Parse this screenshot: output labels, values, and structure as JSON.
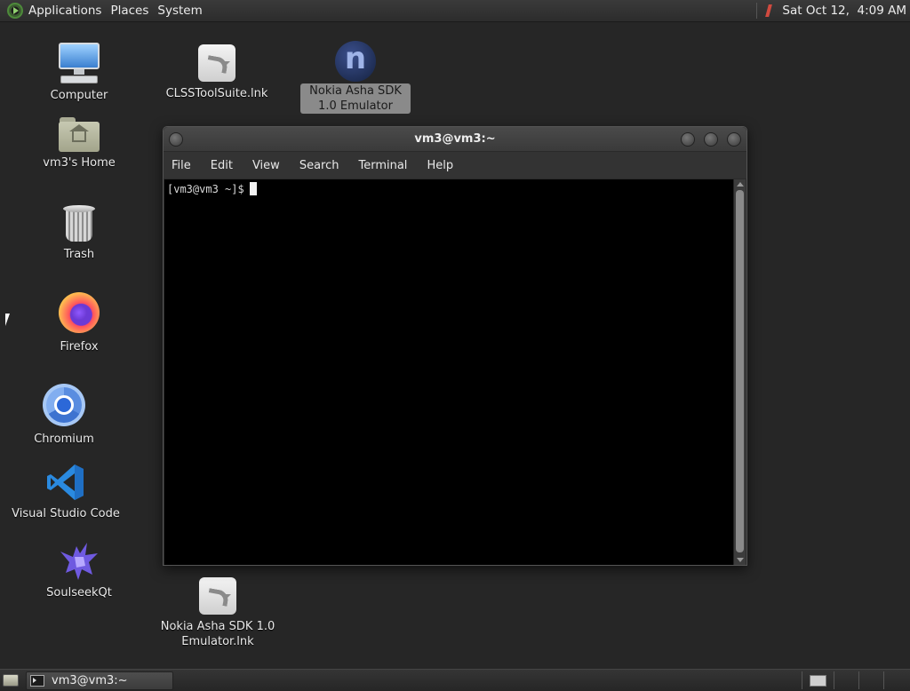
{
  "top_panel": {
    "menus": [
      "Applications",
      "Places",
      "System"
    ],
    "clock": "Sat Oct 12,  4:09 AM"
  },
  "desktop_icons": {
    "computer": "Computer",
    "home": "vm3's Home",
    "trash": "Trash",
    "firefox": "Firefox",
    "chromium": "Chromium",
    "vscode": "Visual Studio Code",
    "soulseek": "SoulseekQt",
    "clss": "CLSSToolSuite.lnk",
    "nokia": "Nokia Asha SDK 1.0 Emulator",
    "nokia_lnk": "Nokia Asha SDK 1.0 Emulator.lnk"
  },
  "terminal": {
    "title": "vm3@vm3:~",
    "menus": [
      "File",
      "Edit",
      "View",
      "Search",
      "Terminal",
      "Help"
    ],
    "prompt": "[vm3@vm3 ~]$"
  },
  "bottom_panel": {
    "task_label": "vm3@vm3:~"
  },
  "colors": {
    "desktop_bg": "#262626",
    "panel_bg": "#2f2f2f",
    "selection_label": "#8a8a8a"
  }
}
